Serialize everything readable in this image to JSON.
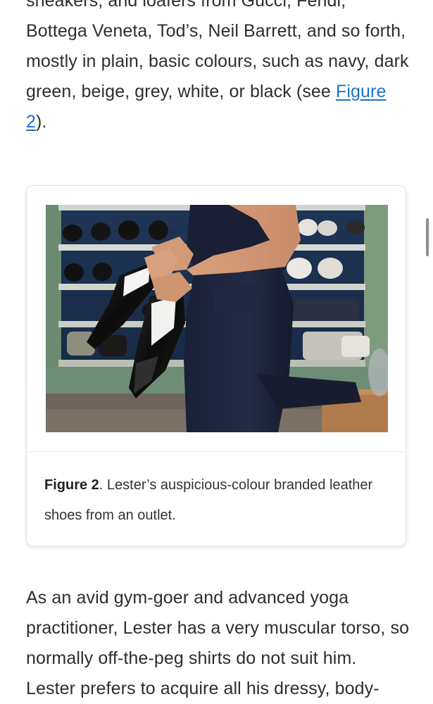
{
  "article": {
    "paragraph_top": {
      "before_link": "sneakers, and loafers from Gucci, Fendi, Bottega Veneta, Tod’s, Neil Barrett, and so forth, mostly in plain, basic colours, such as navy, dark green, beige, grey, white, or black (see ",
      "link_text": "Figure 2",
      "after_link": ")."
    },
    "figure": {
      "caption_label": "Figure 2",
      "caption_text": ". Lester’s auspicious-colour branded leather shoes from an outlet."
    },
    "paragraph_bottom": {
      "text": "As an avid gym-goer and advanced yoga practitioner, Lester has a very muscular torso, so normally off-the-peg shirts do not suit him. Lester prefers to acquire all his dressy, body-"
    }
  }
}
